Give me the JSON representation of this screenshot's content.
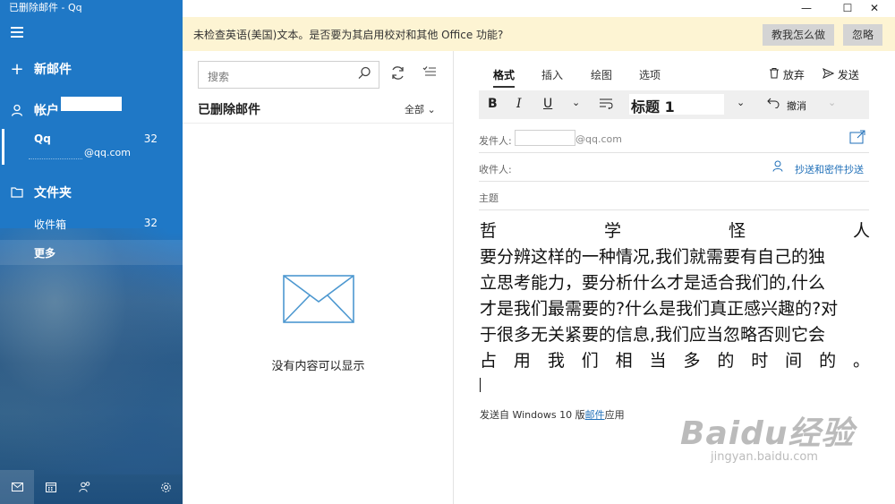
{
  "window": {
    "title": "已删除邮件 - Qq",
    "controls": [
      "—",
      "☐",
      "✕"
    ]
  },
  "sidebar": {
    "new_mail": "新邮件",
    "accounts": "帐户",
    "account": {
      "name": "Qq",
      "count": "32",
      "email": "@qq.com"
    },
    "folders": "文件夹",
    "inbox": {
      "label": "收件箱",
      "count": "32"
    },
    "more": "更多"
  },
  "banner": {
    "text": "未检查英语(美国)文本。是否要为其启用校对和其他 Office 功能?",
    "teach": "教我怎么做",
    "ignore": "忽略"
  },
  "list": {
    "search_placeholder": "搜索",
    "folder_title": "已删除邮件",
    "filter": "全部",
    "empty": "没有内容可以显示"
  },
  "compose": {
    "tabs": [
      "格式",
      "插入",
      "绘图",
      "选项"
    ],
    "discard": "放弃",
    "send": "发送",
    "toolbar": {
      "bold": "B",
      "italic": "I",
      "underline": "U",
      "style": "标题 1",
      "undo": "撤消"
    },
    "from_label": "发件人:",
    "from_domain": "@qq.com",
    "to_label": "收件人:",
    "cc_bcc": "抄送和密件抄送",
    "subject_placeholder": "主题",
    "body": {
      "title_chars": [
        "哲",
        "学",
        "怪",
        "人"
      ],
      "lines": [
        "要分辨这样的一种情况,我们就需要有自己的独",
        "立思考能力，要分析什么才是适合我们的,什么",
        "才是我们最需要的?什么是我们真正感兴趣的?对",
        "于很多无关紧要的信息,我们应当忽略否则它会"
      ],
      "last_chars": [
        "占",
        "用",
        "我",
        "们",
        "相",
        "当",
        "多",
        "的",
        "时",
        "间",
        "的",
        "。"
      ]
    },
    "signature": {
      "prefix": "发送自 Windows 10 版",
      "link": "邮件",
      "suffix": "应用"
    }
  },
  "watermark": {
    "brand": "Baidu经验",
    "url": "jingyan.baidu.com"
  }
}
